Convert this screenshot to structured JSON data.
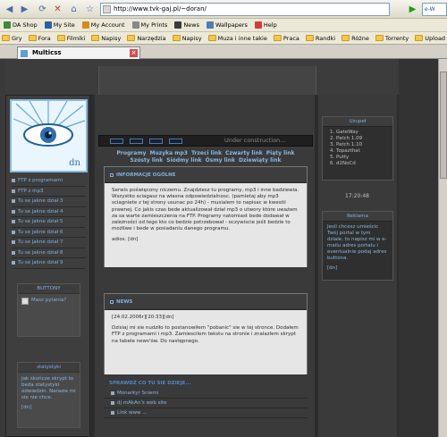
{
  "browser": {
    "url": "http://www.tvk-gaj.pl/~doran/",
    "search_placeholder": "e-W",
    "toolbar2": [
      {
        "label": "DA Shop",
        "icon": "shop-icon",
        "color": "#3a8a3a"
      },
      {
        "label": "My Site",
        "icon": "site-icon",
        "color": "#2a5fa8"
      },
      {
        "label": "My Account",
        "icon": "account-icon",
        "color": "#d88a1a"
      },
      {
        "label": "My Prints",
        "icon": "prints-icon",
        "color": "#888888"
      },
      {
        "label": "News",
        "icon": "news-icon",
        "color": "#3a3a3a"
      },
      {
        "label": "Wallpapers",
        "icon": "wallpaper-icon",
        "color": "#4a7fb0"
      },
      {
        "label": "Help",
        "icon": "help-icon",
        "color": "#d83a3a"
      }
    ],
    "bookmarks": [
      "Gry",
      "Fora",
      "Filmiki",
      "Napisy",
      "Narzędzia",
      "Napisy",
      "Muza i inne takie",
      "Praca",
      "Randki",
      "Różne",
      "Torrenty",
      "Upload"
    ],
    "tab_title": "Multicss"
  },
  "left": {
    "logo_text": "dn",
    "menu": [
      "FTP z programami",
      "FTP z mp3",
      "Tu se jakne dział 3",
      "Tu se jakne dział 4",
      "Tu se jakne dział 5",
      "Tu se jakne dział 6",
      "Tu se jakne dział 7",
      "Tu se jakne dział 8",
      "Tu se jakne dział 9"
    ],
    "buttons_title": "BUTTONY",
    "buttons_body": "Masz pytania?",
    "stats_title": "statystyki",
    "stats_body": "Jak skończe skrypt to beda statystyki odwiedzin. Narazie mi sie nie chce.",
    "stats_footer": "[dn]"
  },
  "center": {
    "construction": "Under construction...",
    "links_row1": [
      "Programy",
      "Muzyka mp3",
      "Trzeci link",
      "Czwarty link",
      "Piąty link"
    ],
    "links_row2": [
      "Szósty link",
      "Siódmy link",
      "Ósmy link",
      "Dziewiąty link"
    ],
    "info_title": "INFORMACJE OGÓLNE",
    "info_body": "Serwis poświęcony niczemu. Znajdziesz tu programy, mp3 i inne badziewia. Wszystko sciagasz na własna odpowiedzialnosc. (pamietaj aby mp3 sciagniete z tej strony usunac po 24h) - musialem to napisac w kwestii prawnej. Co jakis czas bede aktualizował dział mp3 o utwory które uważam za sa warte zamieszczenia na FTP. Programy natomiast bede dodawał w zależności od tego kto co bedzie potrzebował - oczywiscie jeśli bedzie to możliwe i bede w posiadaniu danego programu.",
    "info_sign": "adios. [dn]",
    "news_title": "NEWS",
    "news_date": "[24.02.2006r][20:33][dn]",
    "news_body": "Dzisiaj mi sie nudziło to postanowiłem \"pobanic\" sie w tej stronce. Dodałem FTP z programami i mp3. Zamiescilem tekstu na stronie i znalazlem skrypt na tabele news'ów. Do następnego.",
    "friends_title": "SPRAWDŹ CO TU SIE DZIEJE...",
    "friends": [
      "Monarkyr Sniemi",
      "dj mAkAn's web site",
      "Link www ..."
    ]
  },
  "right": {
    "box1_title": "Uzupeł",
    "box1_items": [
      "GateWay",
      "Patch 1.09",
      "Patch 1.10",
      "Topazthat",
      "Putty",
      "d2NoCd"
    ],
    "clock": "17:20:48",
    "box2_title": "Reklama",
    "box2_body": "Jesli chcesz umieścic Twój portal w tym dziale, to napisz mi w e-mailu adres portalu i eventualnie podaj adres buttona.",
    "box2_footer": "[dn]"
  }
}
